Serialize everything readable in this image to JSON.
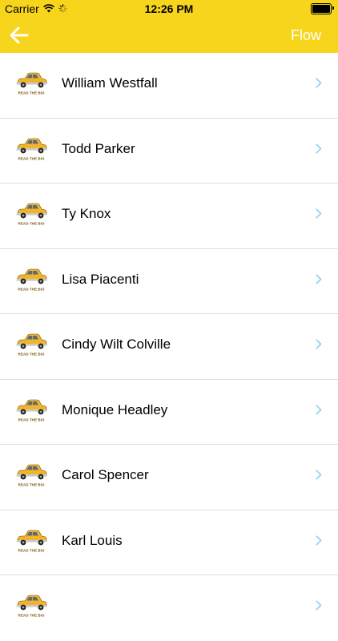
{
  "status_bar": {
    "carrier": "Carrier",
    "time": "12:26 PM"
  },
  "nav": {
    "back_icon": "arrow-left-icon",
    "action_label": "Flow"
  },
  "thumbnail": {
    "icon": "taxi-car-icon",
    "caption": "READ THE BIO"
  },
  "colors": {
    "accent": "#f7d51d",
    "chevron": "#8ecff0"
  },
  "people": [
    {
      "name": "William Westfall"
    },
    {
      "name": "Todd Parker"
    },
    {
      "name": "Ty Knox"
    },
    {
      "name": "Lisa Piacenti"
    },
    {
      "name": "Cindy Wilt Colville"
    },
    {
      "name": "Monique Headley"
    },
    {
      "name": "Carol Spencer"
    },
    {
      "name": "Karl Louis"
    },
    {
      "name": ""
    }
  ]
}
